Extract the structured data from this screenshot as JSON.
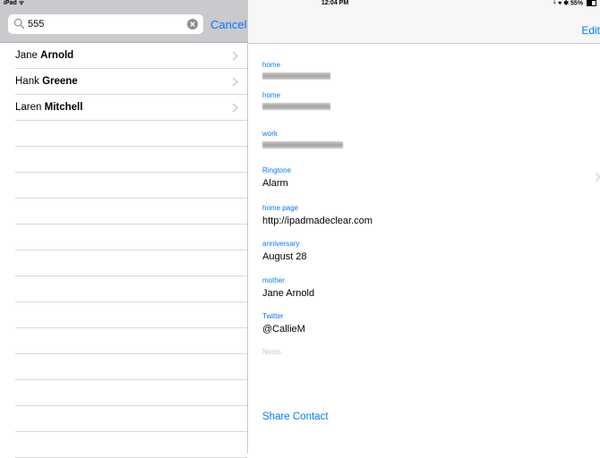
{
  "status_bar": {
    "carrier": "iPad ᯤ",
    "time": "12:04 PM",
    "indicators": "ᴸ ♥ ✱ 55%",
    "battery_percent": 55
  },
  "search": {
    "value": "555",
    "cancel_label": "Cancel"
  },
  "results": [
    {
      "first": "Jane",
      "last": "Arnold"
    },
    {
      "first": "Hank",
      "last": "Greene"
    },
    {
      "first": "Laren",
      "last": "Mitchell"
    }
  ],
  "detail": {
    "edit_label": "Edit",
    "phones": [
      {
        "label": "home",
        "value": ""
      },
      {
        "label": "home",
        "value": ""
      },
      {
        "label": "work",
        "value": ""
      }
    ],
    "ringtone": {
      "label": "Ringtone",
      "value": "Alarm"
    },
    "home_page": {
      "label": "home page",
      "value": "http://ipadmadeclear.com"
    },
    "anniversary": {
      "label": "anniversary",
      "value": "August 28"
    },
    "mother": {
      "label": "mother",
      "value": "Jane Arnold"
    },
    "twitter": {
      "label": "Twitter",
      "value": "@CallieM"
    },
    "notes_placeholder": "Notes",
    "share_label": "Share Contact"
  },
  "colors": {
    "accent": "#007aff",
    "search_bar_bg": "#c9c9ce",
    "nav_bg": "#f7f7f7"
  }
}
